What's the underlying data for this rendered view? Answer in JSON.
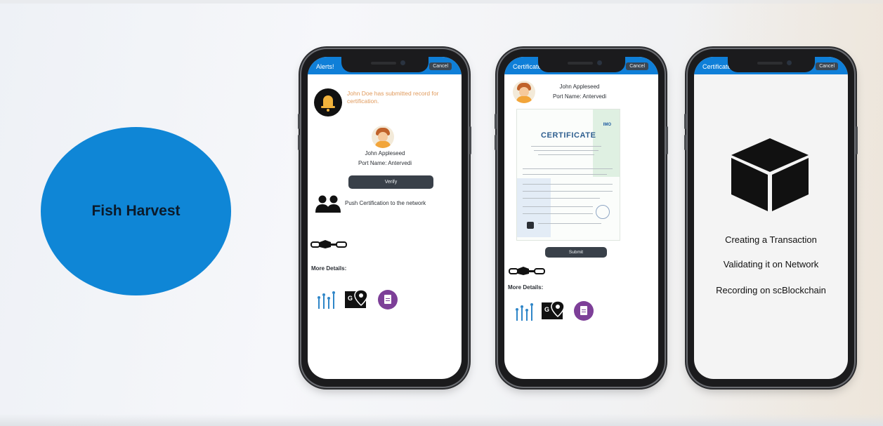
{
  "slide": {
    "bubble_label": "Fish Harvest"
  },
  "colors": {
    "accent_blue": "#0f86d6",
    "status_bar": "#0f7fd8",
    "button_dark": "#394049",
    "alert_orange": "#e09a5c",
    "doc_purple": "#7d3f98"
  },
  "phone1": {
    "title": "Alerts!",
    "cancel_label": "Cancel",
    "alert_text": "John Doe has submitted record for certification.",
    "name": "John Appleseed",
    "port": "Port Name: Antervedi",
    "verify_label": "Verify",
    "push_text": "Push Certification to the network",
    "more_details": "More Details:"
  },
  "phone2": {
    "title": "Certificate",
    "cancel_label": "Cancel",
    "name": "John Appleseed",
    "port": "Port Name: Antervedi",
    "certificate_title": "CERTIFICATE",
    "certificate_logo": "IMO",
    "submit_label": "Submit",
    "more_details": "More Details:"
  },
  "phone3": {
    "title": "Certificate",
    "cancel_label": "Cancel",
    "steps": [
      "Creating a Transaction",
      "Validating it on Network",
      "Recording on scBlockchain"
    ]
  },
  "icons": {
    "bell": "bell-icon",
    "avatar": "avatar",
    "network": "users-icon",
    "chain_logo": "blockchain-logo",
    "stats": "stats-icon",
    "map": "map-icon",
    "document": "document-icon",
    "cube": "cube-icon"
  }
}
